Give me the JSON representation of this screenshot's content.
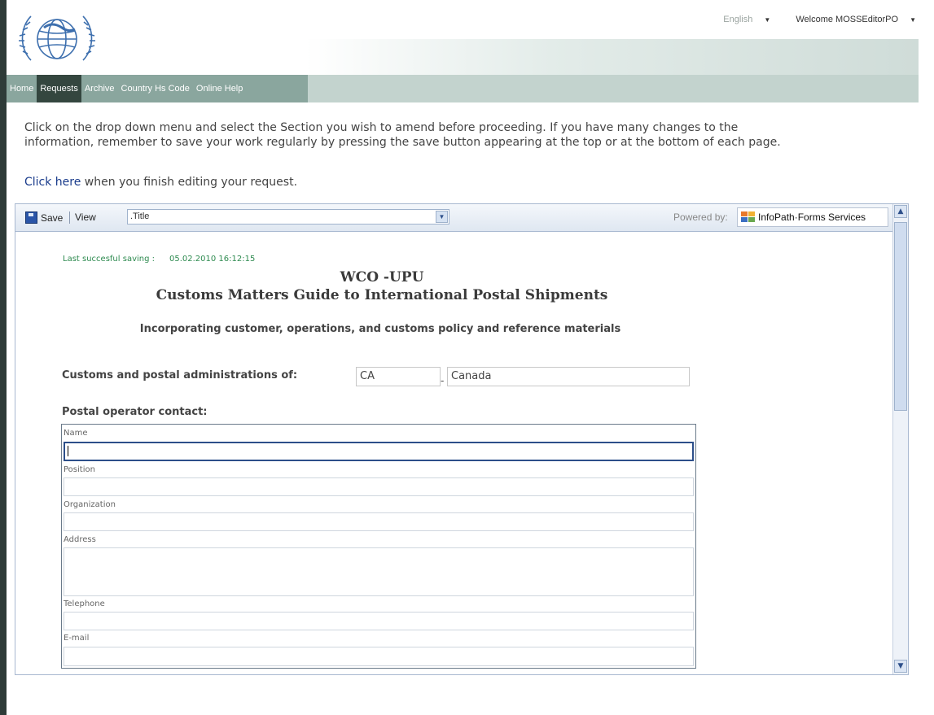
{
  "top_bar": {
    "language": "English",
    "welcome": "Welcome MOSSEditorPO"
  },
  "nav": {
    "items": [
      "Home",
      "Requests",
      "Archive",
      "Country Hs Code",
      "Online Help"
    ],
    "active": "Requests"
  },
  "instructions": {
    "line1": "Click on the drop down menu and select the Section you wish to amend before proceeding. If you have many changes to the",
    "line2": "information, remember to save your work regularly by pressing the save button appearing at the top or at the bottom of each page.",
    "finish_link": "Click here",
    "finish_rest": " when you finish editing your request."
  },
  "toolbar": {
    "save_label": "Save",
    "view_label": "View",
    "view_selected": ".Title",
    "powered_by": "Powered by:",
    "infopath_label": "InfoPath·Forms Services"
  },
  "form": {
    "last_saved_label": "Last succesful saving :",
    "last_saved_time": "05.02.2010 16:12:15",
    "title_line1": "WCO -UPU",
    "title_line2": "Customs Matters Guide to International Postal Shipments",
    "subtitle": "Incorporating customer, operations, and customs policy and reference materials",
    "admin_label": "Customs and postal administrations of:",
    "country_code": "CA",
    "country_dash": "-",
    "country_name": "Canada",
    "contact_title": "Postal operator contact:",
    "fields": {
      "name": "Name",
      "position": "Position",
      "organization": "Organization",
      "address": "Address",
      "telephone": "Telephone",
      "email": "E-mail"
    }
  },
  "colors": {
    "nav_bg": "#8aa69e",
    "nav_active": "#34463f",
    "link": "#1a3c8c",
    "saved_text": "#2d8a4f"
  }
}
